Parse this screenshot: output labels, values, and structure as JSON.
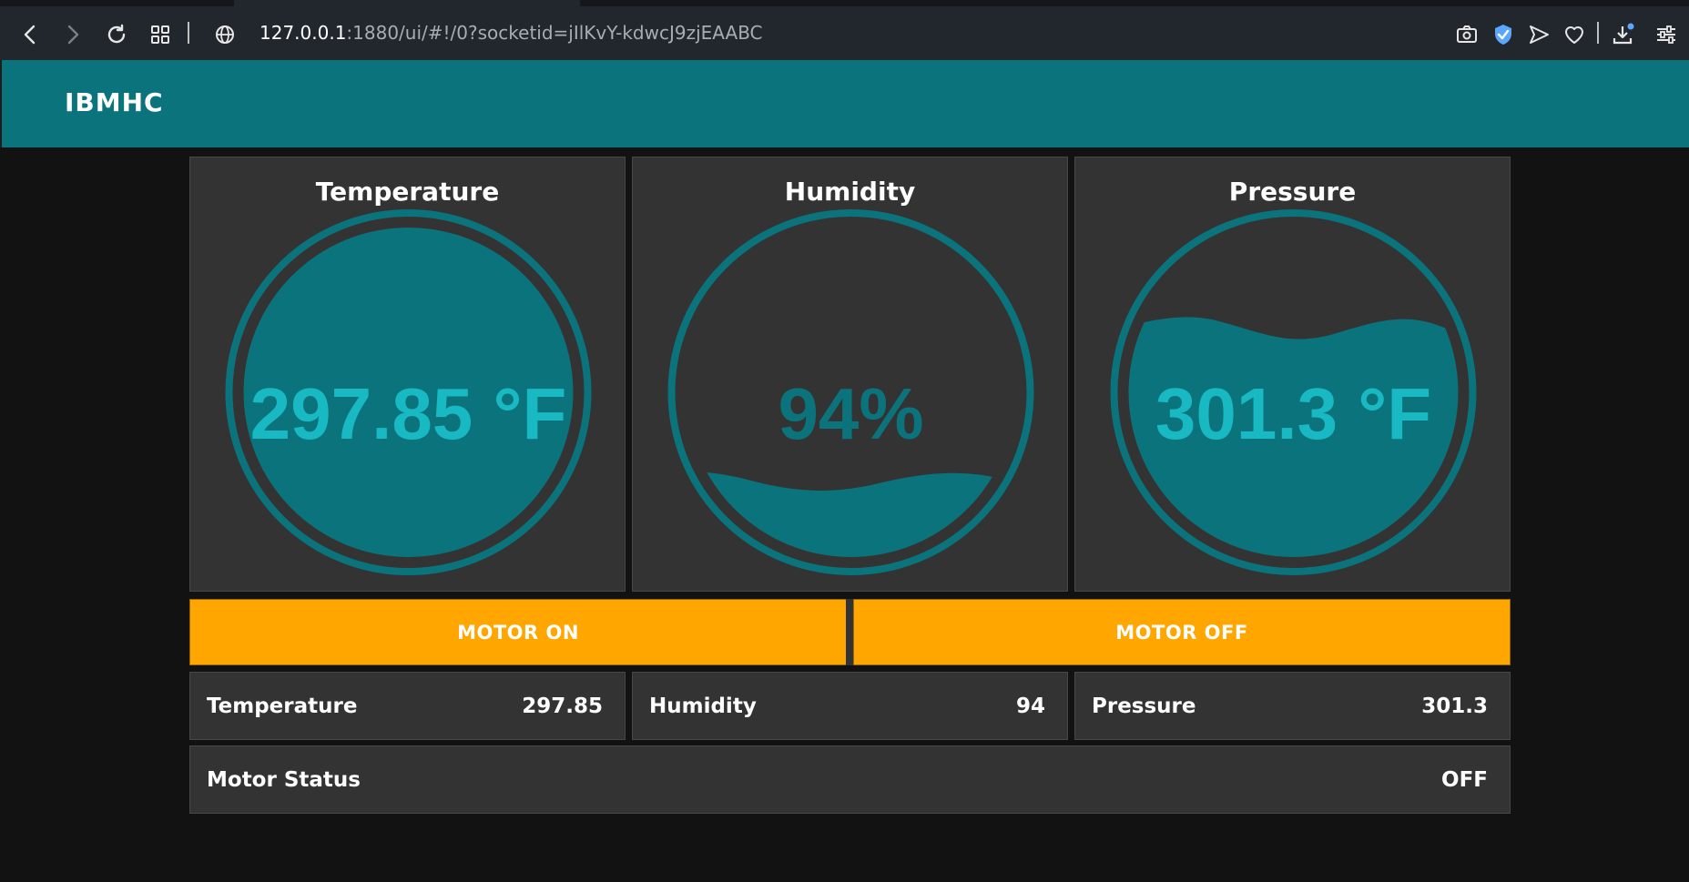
{
  "browser": {
    "url_host": "127.0.0.1",
    "url_rest": ":1880/ui/#!/0?socketid=jIlKvY-kdwcJ9zjEAABC"
  },
  "app": {
    "title": "IBMHC"
  },
  "gauges": [
    {
      "title": "Temperature",
      "value_text": "297.85 °F",
      "fill_level": 1.0
    },
    {
      "title": "Humidity",
      "value_text": "94%",
      "fill_level": 0.2
    },
    {
      "title": "Pressure",
      "value_text": "301.3 °F",
      "fill_level": 0.6
    }
  ],
  "buttons": {
    "motor_on": "MOTOR ON",
    "motor_off": "MOTOR OFF"
  },
  "readings": {
    "temperature": {
      "label": "Temperature",
      "value": "297.85"
    },
    "humidity": {
      "label": "Humidity",
      "value": "94"
    },
    "pressure": {
      "label": "Pressure",
      "value": "301.3"
    },
    "motor_status": {
      "label": "Motor Status",
      "value": "OFF"
    }
  },
  "colors": {
    "accent": "#0b737b",
    "gauge_text": "#18b9c3",
    "button": "#ffa600",
    "panel": "#333333"
  }
}
